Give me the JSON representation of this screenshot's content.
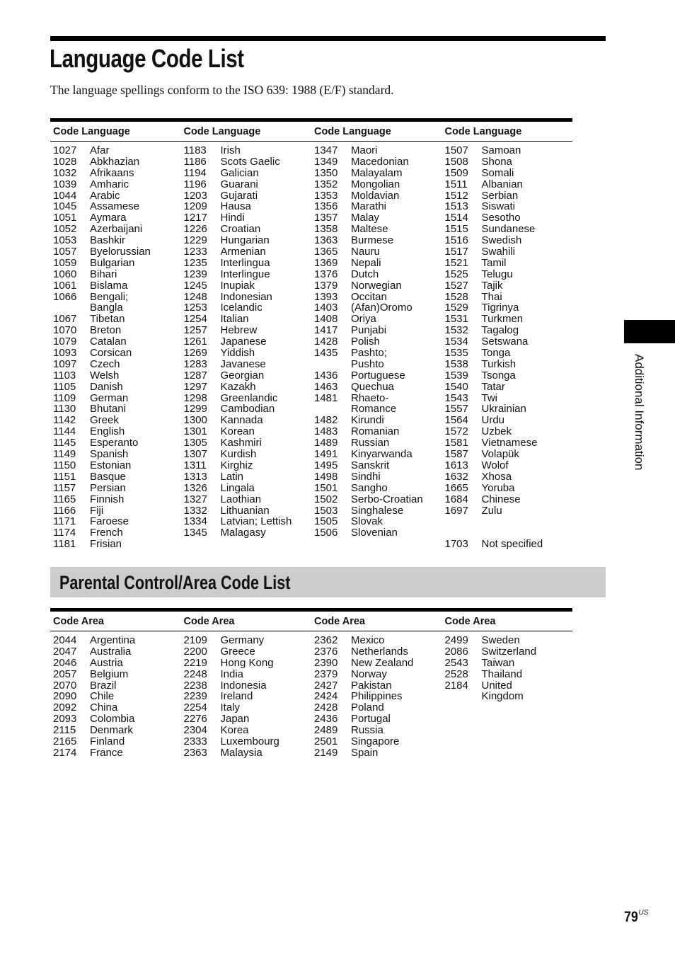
{
  "page": {
    "title": "Language Code List",
    "intro": "The language spellings conform to the ISO 639: 1988 (E/F) standard.",
    "side_tab": "Additional Information",
    "page_number": "79",
    "page_suffix": "US"
  },
  "language_table": {
    "headers": [
      "Code Language",
      "Code Language",
      "Code Language",
      "Code Language"
    ],
    "columns": [
      [
        {
          "code": "1027",
          "name": "Afar"
        },
        {
          "code": "1028",
          "name": "Abkhazian"
        },
        {
          "code": "1032",
          "name": "Afrikaans"
        },
        {
          "code": "1039",
          "name": "Amharic"
        },
        {
          "code": "1044",
          "name": "Arabic"
        },
        {
          "code": "1045",
          "name": "Assamese"
        },
        {
          "code": "1051",
          "name": "Aymara"
        },
        {
          "code": "1052",
          "name": "Azerbaijani"
        },
        {
          "code": "1053",
          "name": "Bashkir"
        },
        {
          "code": "1057",
          "name": "Byelorussian"
        },
        {
          "code": "1059",
          "name": "Bulgarian"
        },
        {
          "code": "1060",
          "name": "Bihari"
        },
        {
          "code": "1061",
          "name": "Bislama"
        },
        {
          "code": "1066",
          "name": "Bengali;"
        },
        {
          "code": "",
          "name": "Bangla"
        },
        {
          "code": "1067",
          "name": "Tibetan"
        },
        {
          "code": "1070",
          "name": "Breton"
        },
        {
          "code": "1079",
          "name": "Catalan"
        },
        {
          "code": "1093",
          "name": "Corsican"
        },
        {
          "code": "1097",
          "name": "Czech"
        },
        {
          "code": "1103",
          "name": "Welsh"
        },
        {
          "code": "1105",
          "name": "Danish"
        },
        {
          "code": "1109",
          "name": "German"
        },
        {
          "code": "1130",
          "name": "Bhutani"
        },
        {
          "code": "1142",
          "name": "Greek"
        },
        {
          "code": "1144",
          "name": "English"
        },
        {
          "code": "1145",
          "name": "Esperanto"
        },
        {
          "code": "1149",
          "name": "Spanish"
        },
        {
          "code": "1150",
          "name": "Estonian"
        },
        {
          "code": "1151",
          "name": "Basque"
        },
        {
          "code": "1157",
          "name": "Persian"
        },
        {
          "code": "1165",
          "name": "Finnish"
        },
        {
          "code": "1166",
          "name": "Fiji"
        },
        {
          "code": "1171",
          "name": "Faroese"
        },
        {
          "code": "1174",
          "name": "French"
        },
        {
          "code": "1181",
          "name": "Frisian"
        }
      ],
      [
        {
          "code": "1183",
          "name": "Irish"
        },
        {
          "code": "1186",
          "name": "Scots Gaelic"
        },
        {
          "code": "1194",
          "name": "Galician"
        },
        {
          "code": "1196",
          "name": "Guarani"
        },
        {
          "code": "1203",
          "name": "Gujarati"
        },
        {
          "code": "1209",
          "name": "Hausa"
        },
        {
          "code": "1217",
          "name": "Hindi"
        },
        {
          "code": "1226",
          "name": "Croatian"
        },
        {
          "code": "1229",
          "name": "Hungarian"
        },
        {
          "code": "1233",
          "name": "Armenian"
        },
        {
          "code": "1235",
          "name": "Interlingua"
        },
        {
          "code": "1239",
          "name": "Interlingue"
        },
        {
          "code": "1245",
          "name": "Inupiak"
        },
        {
          "code": "1248",
          "name": "Indonesian"
        },
        {
          "code": "1253",
          "name": "Icelandic"
        },
        {
          "code": "1254",
          "name": "Italian"
        },
        {
          "code": "1257",
          "name": "Hebrew"
        },
        {
          "code": "1261",
          "name": "Japanese"
        },
        {
          "code": "1269",
          "name": "Yiddish"
        },
        {
          "code": "1283",
          "name": "Javanese"
        },
        {
          "code": "1287",
          "name": "Georgian"
        },
        {
          "code": "1297",
          "name": "Kazakh"
        },
        {
          "code": "1298",
          "name": "Greenlandic"
        },
        {
          "code": "1299",
          "name": "Cambodian"
        },
        {
          "code": "1300",
          "name": "Kannada"
        },
        {
          "code": "1301",
          "name": "Korean"
        },
        {
          "code": "1305",
          "name": "Kashmiri"
        },
        {
          "code": "1307",
          "name": "Kurdish"
        },
        {
          "code": "1311",
          "name": "Kirghiz"
        },
        {
          "code": "1313",
          "name": "Latin"
        },
        {
          "code": "1326",
          "name": "Lingala"
        },
        {
          "code": "1327",
          "name": "Laothian"
        },
        {
          "code": "1332",
          "name": "Lithuanian"
        },
        {
          "code": "1334",
          "name": "Latvian; Lettish"
        },
        {
          "code": "1345",
          "name": "Malagasy"
        }
      ],
      [
        {
          "code": "1347",
          "name": "Maori"
        },
        {
          "code": "1349",
          "name": "Macedonian"
        },
        {
          "code": "1350",
          "name": "Malayalam"
        },
        {
          "code": "1352",
          "name": "Mongolian"
        },
        {
          "code": "1353",
          "name": "Moldavian"
        },
        {
          "code": "1356",
          "name": "Marathi"
        },
        {
          "code": "1357",
          "name": "Malay"
        },
        {
          "code": "1358",
          "name": "Maltese"
        },
        {
          "code": "1363",
          "name": "Burmese"
        },
        {
          "code": "1365",
          "name": "Nauru"
        },
        {
          "code": "1369",
          "name": "Nepali"
        },
        {
          "code": "1376",
          "name": "Dutch"
        },
        {
          "code": "1379",
          "name": "Norwegian"
        },
        {
          "code": "1393",
          "name": "Occitan"
        },
        {
          "code": "1403",
          "name": "(Afan)Oromo"
        },
        {
          "code": "1408",
          "name": "Oriya"
        },
        {
          "code": "1417",
          "name": "Punjabi"
        },
        {
          "code": "1428",
          "name": "Polish"
        },
        {
          "code": "1435",
          "name": "Pashto;"
        },
        {
          "code": "",
          "name": "Pushto"
        },
        {
          "code": "1436",
          "name": "Portuguese"
        },
        {
          "code": "1463",
          "name": "Quechua"
        },
        {
          "code": "1481",
          "name": "Rhaeto-"
        },
        {
          "code": "",
          "name": "Romance"
        },
        {
          "code": "1482",
          "name": "Kirundi"
        },
        {
          "code": "1483",
          "name": "Romanian"
        },
        {
          "code": "1489",
          "name": "Russian"
        },
        {
          "code": "1491",
          "name": "Kinyarwanda"
        },
        {
          "code": "1495",
          "name": "Sanskrit"
        },
        {
          "code": "1498",
          "name": "Sindhi"
        },
        {
          "code": "1501",
          "name": "Sangho"
        },
        {
          "code": "1502",
          "name": "Serbo-Croatian"
        },
        {
          "code": "1503",
          "name": "Singhalese"
        },
        {
          "code": "1505",
          "name": "Slovak"
        },
        {
          "code": "1506",
          "name": "Slovenian"
        }
      ],
      [
        {
          "code": "1507",
          "name": "Samoan"
        },
        {
          "code": "1508",
          "name": "Shona"
        },
        {
          "code": "1509",
          "name": "Somali"
        },
        {
          "code": "1511",
          "name": "Albanian"
        },
        {
          "code": "1512",
          "name": "Serbian"
        },
        {
          "code": "1513",
          "name": "Siswati"
        },
        {
          "code": "1514",
          "name": "Sesotho"
        },
        {
          "code": "1515",
          "name": "Sundanese"
        },
        {
          "code": "1516",
          "name": "Swedish"
        },
        {
          "code": "1517",
          "name": "Swahili"
        },
        {
          "code": "1521",
          "name": "Tamil"
        },
        {
          "code": "1525",
          "name": "Telugu"
        },
        {
          "code": "1527",
          "name": "Tajik"
        },
        {
          "code": "1528",
          "name": "Thai"
        },
        {
          "code": "1529",
          "name": "Tigrinya"
        },
        {
          "code": "1531",
          "name": "Turkmen"
        },
        {
          "code": "1532",
          "name": "Tagalog"
        },
        {
          "code": "1534",
          "name": "Setswana"
        },
        {
          "code": "1535",
          "name": "Tonga"
        },
        {
          "code": "1538",
          "name": "Turkish"
        },
        {
          "code": "1539",
          "name": "Tsonga"
        },
        {
          "code": "1540",
          "name": "Tatar"
        },
        {
          "code": "1543",
          "name": "Twi"
        },
        {
          "code": "1557",
          "name": "Ukrainian"
        },
        {
          "code": "1564",
          "name": "Urdu"
        },
        {
          "code": "1572",
          "name": "Uzbek"
        },
        {
          "code": "1581",
          "name": "Vietnamese"
        },
        {
          "code": "1587",
          "name": "Volapük"
        },
        {
          "code": "1613",
          "name": "Wolof"
        },
        {
          "code": "1632",
          "name": "Xhosa"
        },
        {
          "code": "1665",
          "name": "Yoruba"
        },
        {
          "code": "1684",
          "name": "Chinese"
        },
        {
          "code": "1697",
          "name": "Zulu"
        },
        {
          "code": "",
          "name": ""
        },
        {
          "code": "",
          "name": ""
        },
        {
          "code": "1703",
          "name": "Not specified"
        }
      ]
    ]
  },
  "area_section": {
    "title": "Parental Control/Area Code List"
  },
  "area_table": {
    "headers": [
      "Code Area",
      "Code Area",
      "Code Area",
      "Code Area"
    ],
    "columns": [
      [
        {
          "code": "2044",
          "name": "Argentina"
        },
        {
          "code": "2047",
          "name": "Australia"
        },
        {
          "code": "2046",
          "name": "Austria"
        },
        {
          "code": "2057",
          "name": "Belgium"
        },
        {
          "code": "2070",
          "name": "Brazil"
        },
        {
          "code": "2090",
          "name": "Chile"
        },
        {
          "code": "2092",
          "name": "China"
        },
        {
          "code": "2093",
          "name": "Colombia"
        },
        {
          "code": "2115",
          "name": "Denmark"
        },
        {
          "code": "2165",
          "name": "Finland"
        },
        {
          "code": "2174",
          "name": "France"
        }
      ],
      [
        {
          "code": "2109",
          "name": "Germany"
        },
        {
          "code": "2200",
          "name": "Greece"
        },
        {
          "code": "2219",
          "name": "Hong Kong"
        },
        {
          "code": "2248",
          "name": "India"
        },
        {
          "code": "2238",
          "name": "Indonesia"
        },
        {
          "code": "2239",
          "name": "Ireland"
        },
        {
          "code": "2254",
          "name": "Italy"
        },
        {
          "code": "2276",
          "name": "Japan"
        },
        {
          "code": "2304",
          "name": "Korea"
        },
        {
          "code": "2333",
          "name": "Luxembourg"
        },
        {
          "code": "2363",
          "name": "Malaysia"
        }
      ],
      [
        {
          "code": "2362",
          "name": "Mexico"
        },
        {
          "code": "2376",
          "name": "Netherlands"
        },
        {
          "code": "2390",
          "name": "New Zealand"
        },
        {
          "code": "2379",
          "name": "Norway"
        },
        {
          "code": "2427",
          "name": "Pakistan"
        },
        {
          "code": "2424",
          "name": "Philippines"
        },
        {
          "code": "2428",
          "name": "Poland"
        },
        {
          "code": "2436",
          "name": "Portugal"
        },
        {
          "code": "2489",
          "name": "Russia"
        },
        {
          "code": "2501",
          "name": "Singapore"
        },
        {
          "code": "2149",
          "name": "Spain"
        }
      ],
      [
        {
          "code": "2499",
          "name": "Sweden"
        },
        {
          "code": "2086",
          "name": "Switzerland"
        },
        {
          "code": "2543",
          "name": "Taiwan"
        },
        {
          "code": "2528",
          "name": "Thailand"
        },
        {
          "code": "2184",
          "name": "United"
        },
        {
          "code": "",
          "name": "Kingdom"
        }
      ]
    ]
  }
}
